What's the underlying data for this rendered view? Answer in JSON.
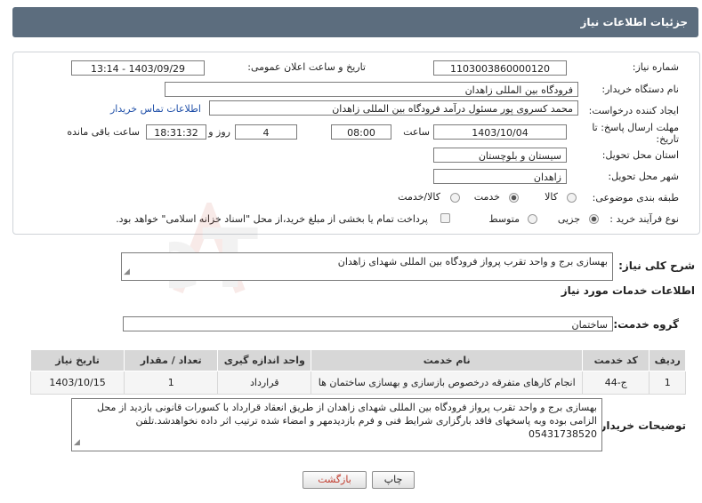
{
  "header": {
    "title": "جزئیات اطلاعات نیاز"
  },
  "form": {
    "need_number": {
      "label": "شماره نیاز:",
      "value": "1103003860000120"
    },
    "announce_datetime": {
      "label": "تاریخ و ساعت اعلان عمومی:",
      "value": "1403/09/29 - 13:14"
    },
    "buyer_org": {
      "label": "نام دستگاه خریدار:",
      "value": "فرودگاه بین المللی زاهدان"
    },
    "requester": {
      "label": "ایجاد کننده درخواست:",
      "value": "محمد کسروی پور مسئول درآمد فرودگاه بین المللی زاهدان"
    },
    "contact_link": "اطلاعات تماس خریدار",
    "deadline": {
      "label_line1": "مهلت ارسال پاسخ: تا",
      "label_line2": "تاریخ:",
      "date": "1403/10/04",
      "time_label": "ساعت",
      "time": "08:00",
      "days": "4",
      "days_label": "روز و",
      "remaining": "18:31:32",
      "remaining_label": "ساعت باقی مانده"
    },
    "province": {
      "label": "استان محل تحویل:",
      "value": "سیستان و بلوچستان"
    },
    "city": {
      "label": "شهر محل تحویل:",
      "value": "زاهدان"
    },
    "category": {
      "label": "طبقه بندی موضوعی:",
      "options": [
        "کالا",
        "خدمت",
        "کالا/خدمت"
      ],
      "selected": "خدمت"
    },
    "process_type": {
      "label": "نوع فرآیند خرید :",
      "options": [
        "جزیی",
        "متوسط"
      ],
      "selected": "جزیی",
      "payment_note": "پرداخت تمام یا بخشی از مبلغ خرید،از محل \"اسناد خزانه اسلامی\" خواهد بود."
    }
  },
  "summary": {
    "label": "شرح کلی نیاز:",
    "value": "بهسازی برج و واحد تقرب پرواز فرودگاه بین المللی شهدای زاهدان"
  },
  "services": {
    "section_title": "اطلاعات خدمات مورد نیاز",
    "group_label": "گروه خدمت:",
    "group_value": "ساختمان",
    "columns": [
      "ردیف",
      "کد خدمت",
      "نام خدمت",
      "واحد اندازه گیری",
      "تعداد / مقدار",
      "تاریخ نیاز"
    ],
    "rows": [
      [
        "1",
        "ج-44",
        "انجام کارهای متفرقه درخصوص بازسازی و بهسازی ساختمان ها",
        "قرارداد",
        "1",
        "1403/10/15"
      ]
    ]
  },
  "buyer_notes": {
    "label": "توضیحات خریدار:",
    "value": "بهسازی برج و واحد تقرب پرواز فرودگاه بین المللی شهدای زاهدان از طریق انعقاد قرارداد با کسورات قانونی بازدید از محل الزامی بوده وبه پاسخهای فاقد بارگزاری شرایط فنی و فرم بازدیدمهر و امضاء شده ترتیب اثر داده نخواهدشد.تلفن 05431738520"
  },
  "actions": {
    "print": "چاپ",
    "back": "بازگشت"
  },
  "watermark": {
    "text": "AriaTender.neT"
  },
  "colors": {
    "header_bg": "#5c6d7e",
    "link": "#1f4fa8",
    "back_text": "#c0392b"
  }
}
